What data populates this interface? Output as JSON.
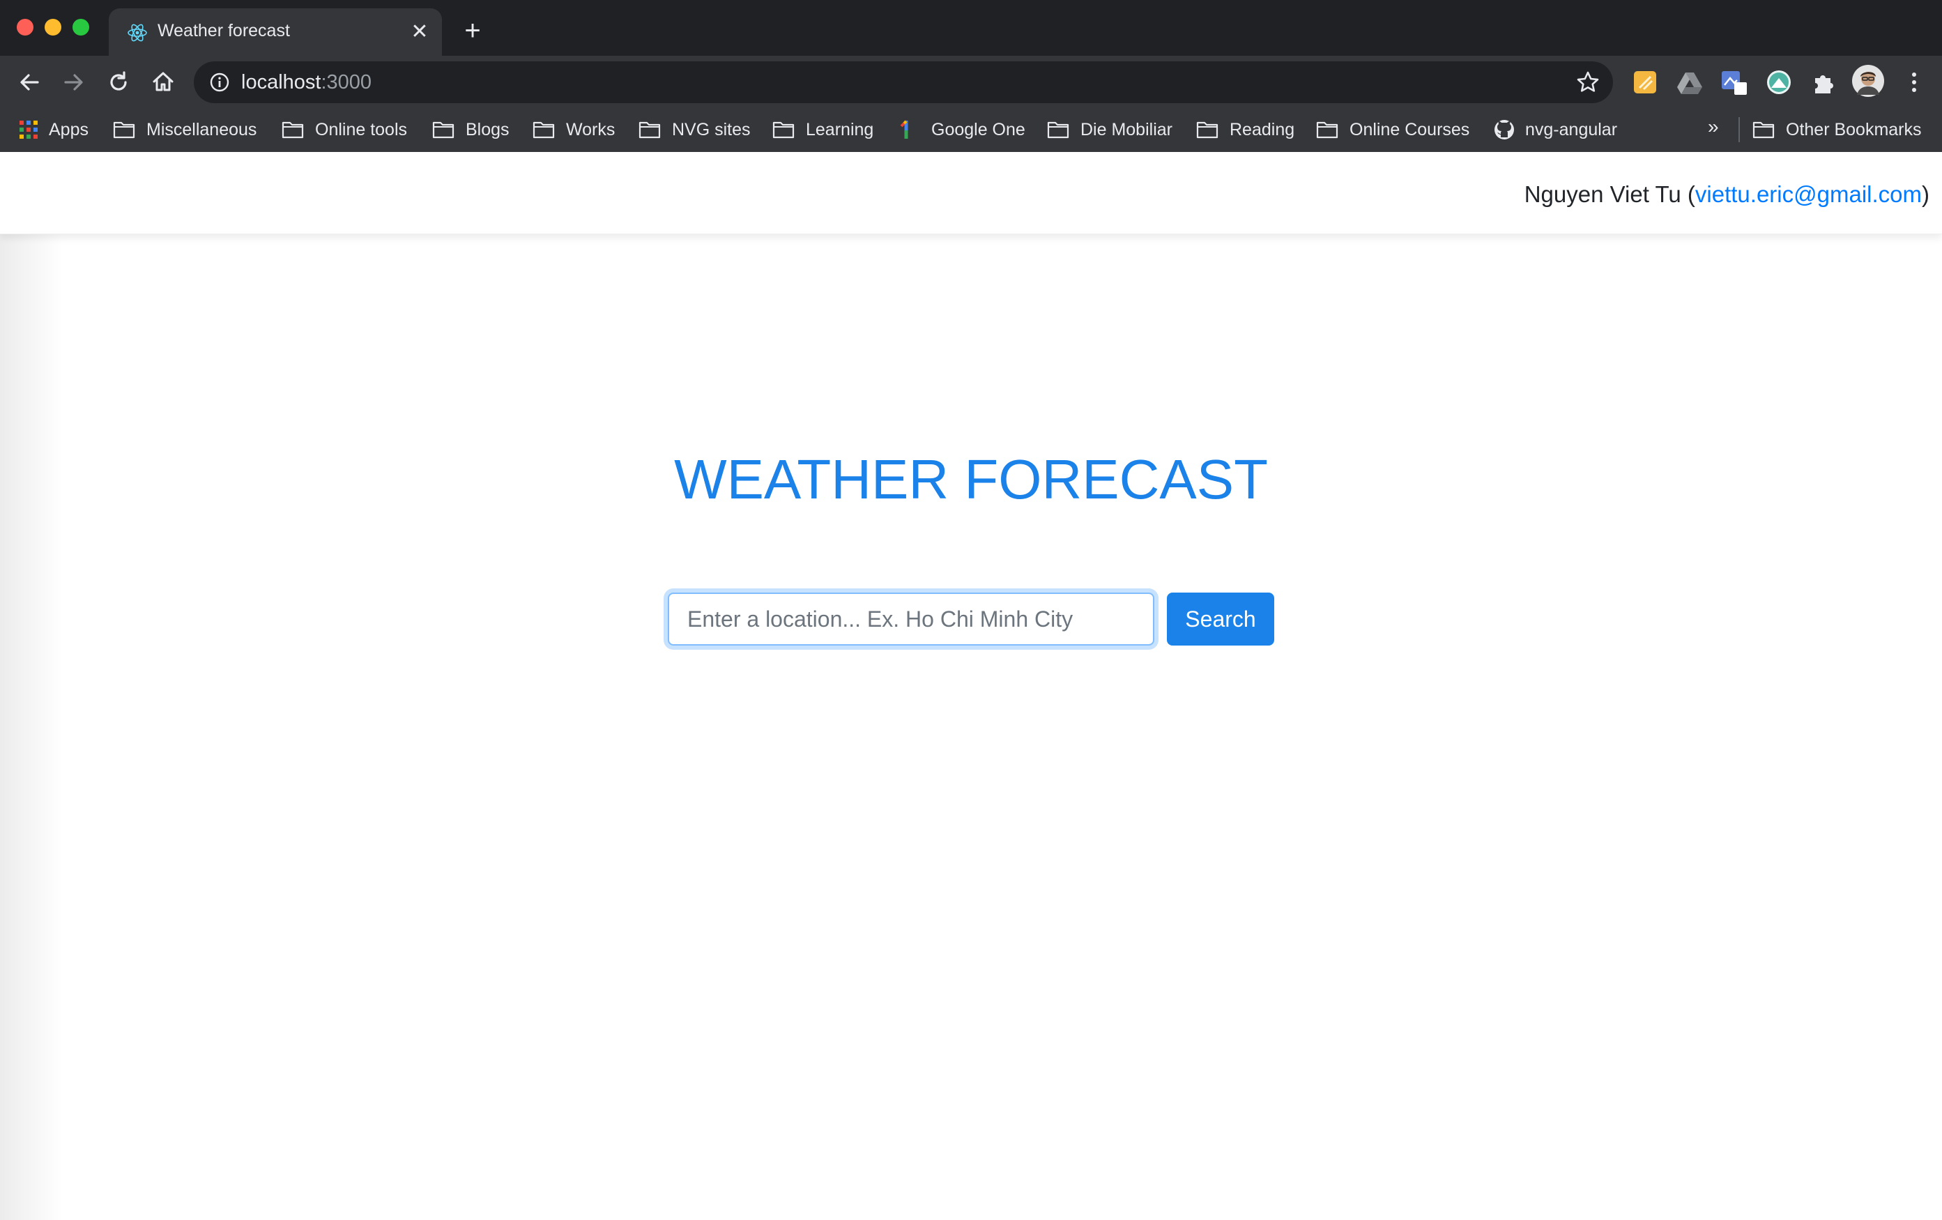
{
  "browser": {
    "tab": {
      "title": "Weather forecast",
      "close_glyph": "✕"
    },
    "new_tab_glyph": "+",
    "address": {
      "host": "localhost",
      "port": ":3000"
    },
    "bookmarks": [
      {
        "label": "Apps",
        "icon": "apps-grid-icon"
      },
      {
        "label": "Miscellaneous",
        "icon": "folder-icon"
      },
      {
        "label": "Online tools",
        "icon": "folder-icon"
      },
      {
        "label": "Blogs",
        "icon": "folder-icon"
      },
      {
        "label": "Works",
        "icon": "folder-icon"
      },
      {
        "label": "NVG sites",
        "icon": "folder-icon"
      },
      {
        "label": "Learning",
        "icon": "folder-icon"
      },
      {
        "label": "Google One",
        "icon": "google-one-icon"
      },
      {
        "label": "Die Mobiliar",
        "icon": "folder-icon"
      },
      {
        "label": "Reading",
        "icon": "folder-icon"
      },
      {
        "label": "Online Courses",
        "icon": "folder-icon"
      },
      {
        "label": "nvg-angular",
        "icon": "github-icon"
      }
    ],
    "bookmarks_overflow": "»",
    "other_bookmarks": "Other Bookmarks"
  },
  "page": {
    "author": {
      "name": "Nguyen Viet Tu (",
      "email": "viettu.eric@gmail.com",
      "suffix": ")"
    },
    "title": "WEATHER FORECAST",
    "search": {
      "placeholder": "Enter a location... Ex. Ho Chi Minh City",
      "value": "",
      "button_label": "Search"
    }
  },
  "colors": {
    "accent": "#1a82e8",
    "chrome_dark": "#202124",
    "chrome_toolbar": "#35363a"
  }
}
